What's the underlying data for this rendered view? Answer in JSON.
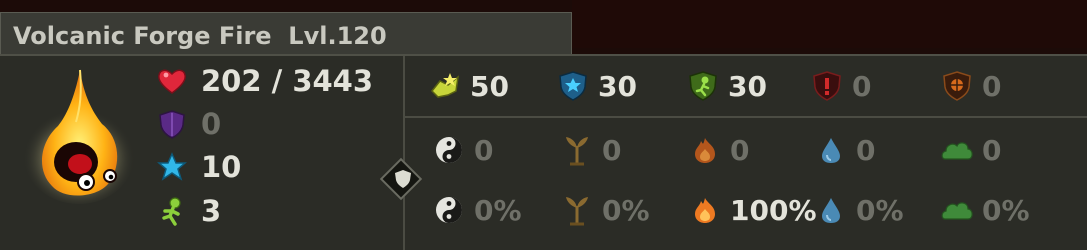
{
  "header": {
    "title": "Volcanic Forge Fire  Lvl.120"
  },
  "stats": {
    "hp": "202 / 3443",
    "armor": "0",
    "ap": "10",
    "mp": "3"
  },
  "top_row": [
    {
      "icon": "initiative-icon",
      "value": "50",
      "dim": false
    },
    {
      "icon": "ap-shield-icon",
      "value": "30",
      "dim": false
    },
    {
      "icon": "mp-shield-icon",
      "value": "30",
      "dim": false
    },
    {
      "icon": "critical-icon",
      "value": "0",
      "dim": true
    },
    {
      "icon": "block-icon",
      "value": "0",
      "dim": true
    }
  ],
  "resist_flat": [
    {
      "icon": "yin-yang-icon",
      "value": "0"
    },
    {
      "icon": "earth-sprout-icon",
      "value": "0"
    },
    {
      "icon": "fire-icon",
      "value": "0"
    },
    {
      "icon": "water-drop-icon",
      "value": "0"
    },
    {
      "icon": "air-cloud-icon",
      "value": "0"
    }
  ],
  "resist_pct": [
    {
      "icon": "yin-yang-icon",
      "value": "0%",
      "dim": true
    },
    {
      "icon": "earth-sprout-icon",
      "value": "0%",
      "dim": true
    },
    {
      "icon": "fire-icon",
      "value": "100%",
      "dim": false
    },
    {
      "icon": "water-drop-icon",
      "value": "0%",
      "dim": true
    },
    {
      "icon": "air-cloud-icon",
      "value": "0%",
      "dim": true
    }
  ],
  "colors": {
    "text": "#e3e3da",
    "dim": "#6f7068",
    "panel": "#2b2c26",
    "accent_fire": "#e8761c"
  }
}
